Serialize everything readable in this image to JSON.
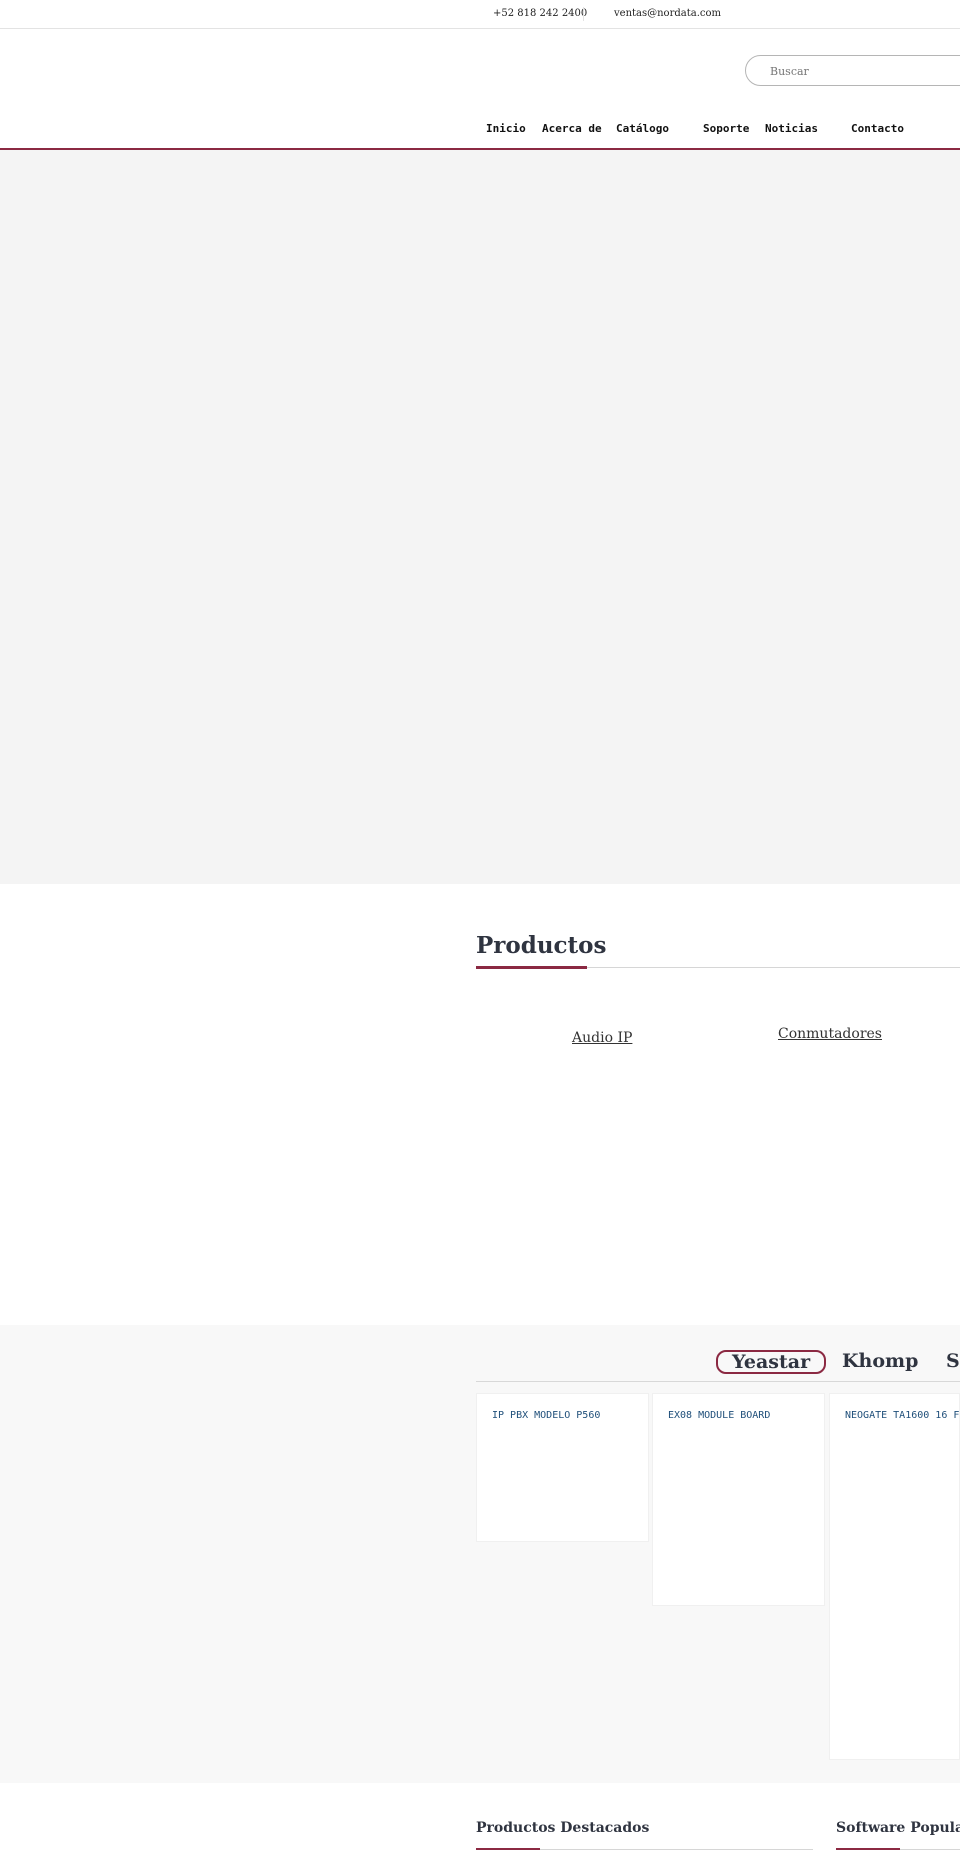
{
  "topbar": {
    "phone": "+52 818 242 2400",
    "email": "ventas@nordata.com"
  },
  "search": {
    "placeholder": "Buscar"
  },
  "nav": {
    "items": [
      "Inicio",
      "Acerca de",
      "Catálogo",
      "Soporte",
      "Noticias",
      "Contacto"
    ]
  },
  "products": {
    "title": "Productos",
    "categories": [
      "Audio IP",
      "Conmutadores"
    ]
  },
  "brands": {
    "tabs": [
      "Yeastar",
      "Khomp",
      "S"
    ],
    "active_tab": "Yeastar",
    "cards": [
      "IP PBX MODELO P560",
      "EX08 MODULE BOARD",
      "NEOGATE TA1600 16 F"
    ]
  },
  "footer_sections": {
    "featured": "Productos Destacados",
    "software": "Software Popular"
  },
  "colors": {
    "accent": "#8b2942",
    "link": "#1f4f7a",
    "hero_bg": "#f4f4f4",
    "section_bg": "#f8f8f8"
  }
}
